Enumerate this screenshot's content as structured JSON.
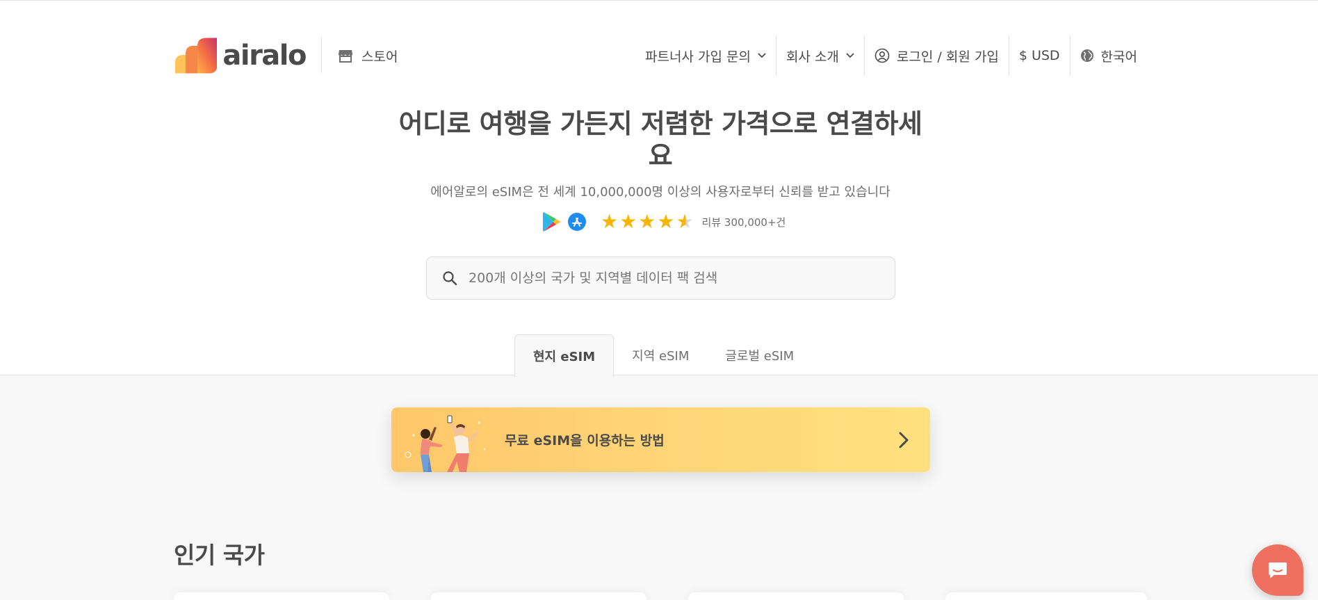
{
  "header": {
    "logo_text": "airalo",
    "store_label": "스토어",
    "nav": {
      "partner": "파트너사 가입 문의",
      "company": "회사 소개",
      "login": "로그인 / 회원 가입",
      "currency": "$ USD",
      "language": "한국어"
    }
  },
  "hero": {
    "title": "어디로 여행을 가든지 저렴한 가격으로 연결하세요",
    "subtitle": "에어알로의 eSIM은 전 세계 10,000,000명 이상의 사용자로부터 신뢰를 받고 있습니다",
    "rating": {
      "stars": 4.5,
      "reviews_label": "리뷰 300,000+건"
    }
  },
  "search": {
    "placeholder": "200개 이상의 국가 및 지역별 데이터 팩 검색"
  },
  "tabs": [
    {
      "label": "현지 eSIM",
      "active": true
    },
    {
      "label": "지역 eSIM",
      "active": false
    },
    {
      "label": "글로벌 eSIM",
      "active": false
    }
  ],
  "banner": {
    "text": "무료 eSIM을 이용하는 방법"
  },
  "popular": {
    "title": "인기 국가"
  },
  "colors": {
    "text": "#4a4a4a",
    "star": "#f7b500",
    "chat": "#ef6f60",
    "banner_start": "#ffc769",
    "banner_end": "#ffe07f"
  },
  "icons": [
    "store-icon",
    "chevron-down-icon",
    "user-icon",
    "globe-icon",
    "google-play-icon",
    "app-store-icon",
    "star-icon",
    "search-icon",
    "chevron-right-icon",
    "chat-icon"
  ]
}
